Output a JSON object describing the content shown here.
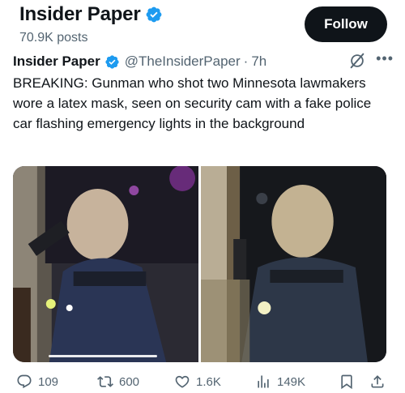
{
  "profile": {
    "name": "Insider Paper",
    "posts": "70.9K posts",
    "follow_label": "Follow"
  },
  "tweet": {
    "author": "Insider Paper",
    "handle": "@TheInsiderPaper",
    "separator": "·",
    "time": "7h",
    "text": "BREAKING: Gunman who shot two Minnesota lawmakers wore a latex mask, seen on security cam with a fake police car flashing emergency lights in the background"
  },
  "media": {
    "panels": 2,
    "video_progress": 0.3
  },
  "actions": {
    "replies": "109",
    "retweets": "600",
    "likes": "1.6K",
    "views": "149K"
  },
  "icons": {
    "verified": "verified-badge-icon",
    "grok": "grok-icon",
    "more": "more-icon",
    "reply": "reply-icon",
    "retweet": "retweet-icon",
    "like": "heart-icon",
    "views": "views-icon",
    "bookmark": "bookmark-icon",
    "share": "share-icon"
  },
  "colors": {
    "text": "#0f1419",
    "secondary": "#536471",
    "verified": "#1d9bf0",
    "follow_bg": "#0f1419"
  }
}
